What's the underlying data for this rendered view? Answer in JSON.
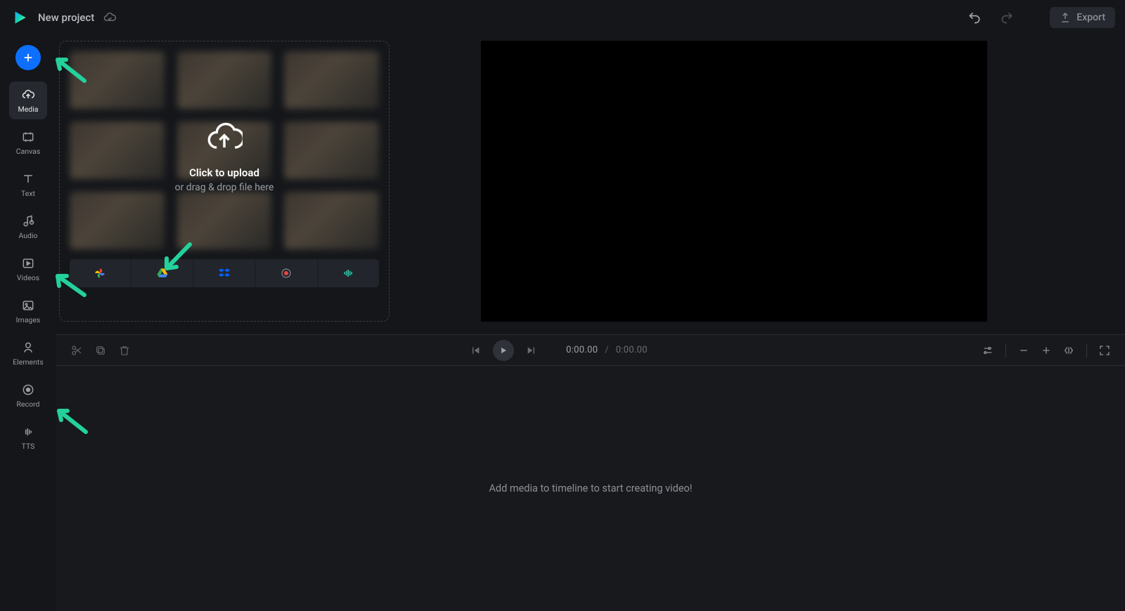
{
  "header": {
    "project_name": "New project",
    "export_label": "Export"
  },
  "sidebar": {
    "items": [
      {
        "label": "Media",
        "icon": "upload-cloud"
      },
      {
        "label": "Canvas",
        "icon": "frame"
      },
      {
        "label": "Text",
        "icon": "text"
      },
      {
        "label": "Audio",
        "icon": "music-note"
      },
      {
        "label": "Videos",
        "icon": "play-rect"
      },
      {
        "label": "Images",
        "icon": "image"
      },
      {
        "label": "Elements",
        "icon": "shapes"
      },
      {
        "label": "Record",
        "icon": "record-circle"
      },
      {
        "label": "TTS",
        "icon": "waveform"
      }
    ]
  },
  "media_panel": {
    "upload_title": "Click to upload",
    "upload_subtitle": "or drag & drop file here",
    "sources": [
      "google-photos",
      "google-drive",
      "dropbox",
      "record",
      "audio-wave"
    ]
  },
  "playback": {
    "current": "0:00.00",
    "total": "0:00.00"
  },
  "timeline": {
    "placeholder": "Add media to timeline to start creating video!"
  }
}
